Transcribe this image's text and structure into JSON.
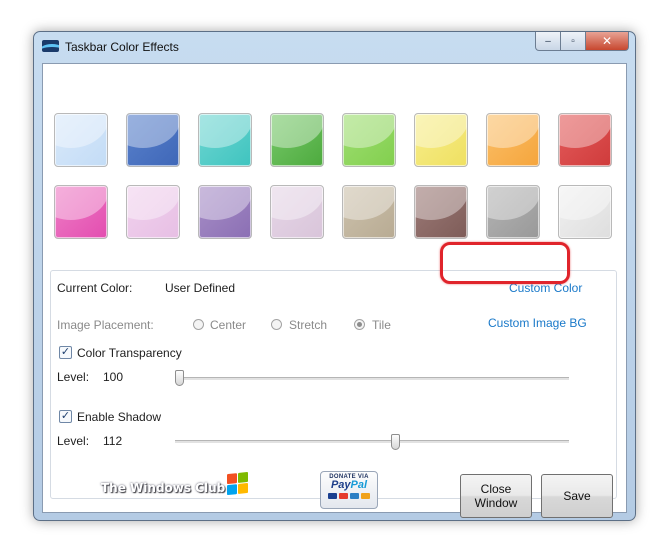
{
  "window": {
    "title": "Taskbar Color Effects"
  },
  "caption_buttons": {
    "minimize": "–",
    "maximize": "▫",
    "close": "✕"
  },
  "swatches": [
    {
      "color": "#d9e9fa",
      "accent": "#c3dcf6"
    },
    {
      "color": "#5a82cc",
      "accent": "#3f67b8"
    },
    {
      "color": "#6fd6d2",
      "accent": "#3fc4bf"
    },
    {
      "color": "#78c96a",
      "accent": "#4daa3e"
    },
    {
      "color": "#9fde72",
      "accent": "#82cf4e"
    },
    {
      "color": "#f7ee8c",
      "accent": "#efe061"
    },
    {
      "color": "#fbc06a",
      "accent": "#f5a53c"
    },
    {
      "color": "#e45c5c",
      "accent": "#cf3b3b"
    },
    {
      "color": "#ee7fc6",
      "accent": "#e34db0"
    },
    {
      "color": "#f1d2ee",
      "accent": "#e7bfe4"
    },
    {
      "color": "#a88fc7",
      "accent": "#8b6fb4"
    },
    {
      "color": "#e6d6e7",
      "accent": "#d9c5da"
    },
    {
      "color": "#cdc2ad",
      "accent": "#b8ab93"
    },
    {
      "color": "#9d7b78",
      "accent": "#7e5c58"
    },
    {
      "color": "#b5b5b5",
      "accent": "#999999"
    },
    {
      "color": "#f1f1f1",
      "accent": "#dedede"
    }
  ],
  "settings": {
    "current_color_label": "Current Color:",
    "current_color_value": "User Defined",
    "custom_color_link": "Custom Color",
    "image_placement_label": "Image Placement:",
    "placement_options": [
      "Center",
      "Stretch",
      "Tile"
    ],
    "placement_selected": "Tile",
    "custom_image_link": "Custom Image BG",
    "transparency": {
      "label": "Color Transparency",
      "checked": true,
      "level_label": "Level:",
      "level_value": "100",
      "fraction": 0.0
    },
    "shadow": {
      "label": "Enable Shadow",
      "checked": true,
      "level_label": "Level:",
      "level_value": "112",
      "fraction": 0.56
    }
  },
  "footer": {
    "logo_text": "The Windows Club",
    "paypal_top": "DONATE VIA",
    "paypal_brand_a": "Pay",
    "paypal_brand_b": "Pal",
    "close_button": "Close Window",
    "save_button": "Save"
  },
  "colors": {
    "link": "#1a79c9",
    "highlight": "#e0242b"
  }
}
